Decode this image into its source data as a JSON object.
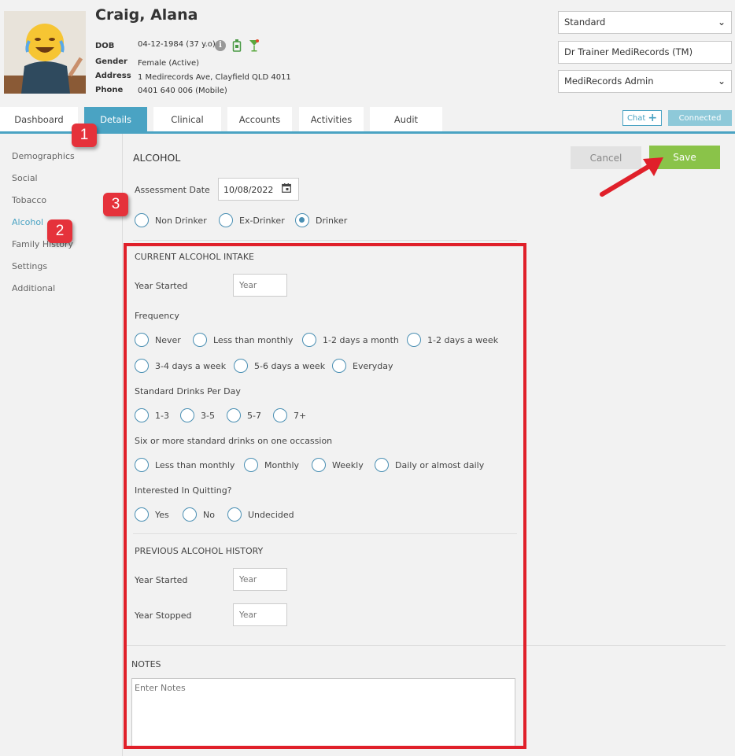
{
  "patient": {
    "name": "Craig, Alana",
    "dob_label": "DOB",
    "dob": "04-12-1984 (37 y.o)",
    "gender_label": "Gender",
    "gender": "Female (Active)",
    "address_label": "Address",
    "address": "1 Medirecords Ave, Clayfield QLD 4011",
    "phone_label": "Phone",
    "phone": "0401 640 006 (Mobile)",
    "icons": [
      "info-icon",
      "bottle-icon",
      "cocktail-icon"
    ]
  },
  "header_controls": {
    "mode_select": "Standard",
    "practitioner": "Dr Trainer MediRecords (TM)",
    "role_select": "MediRecords Admin"
  },
  "tabs": [
    "Dashboard",
    "Details",
    "Clinical",
    "Accounts",
    "Activities",
    "Audit"
  ],
  "active_tab": "Details",
  "chat_label": "Chat",
  "connected_label": "Connected",
  "sidebar": [
    "Demographics",
    "Social",
    "Tobacco",
    "Alcohol",
    "Family History",
    "Settings",
    "Additional"
  ],
  "active_sidebar": "Alcohol",
  "badges": [
    "1",
    "2",
    "3"
  ],
  "form": {
    "title": "ALCOHOL",
    "cancel_label": "Cancel",
    "save_label": "Save",
    "assessment_date_label": "Assessment Date",
    "assessment_date": "10/08/2022",
    "drinker_status": [
      "Non Drinker",
      "Ex-Drinker",
      "Drinker"
    ],
    "drinker_selected": "Drinker",
    "current_title": "CURRENT ALCOHOL INTAKE",
    "year_started_label": "Year Started",
    "year_placeholder": "Year",
    "frequency_label": "Frequency",
    "frequency_options": [
      "Never",
      "Less than monthly",
      "1-2 days a month",
      "1-2 days a week",
      "3-4 days a week",
      "5-6 days a week",
      "Everyday"
    ],
    "drinks_label": "Standard Drinks Per Day",
    "drinks_options": [
      "1-3",
      "3-5",
      "5-7",
      "7+"
    ],
    "six_label": "Six or more standard drinks on one occassion",
    "six_options": [
      "Less than monthly",
      "Monthly",
      "Weekly",
      "Daily or almost daily"
    ],
    "quit_label": "Interested In Quitting?",
    "quit_options": [
      "Yes",
      "No",
      "Undecided"
    ],
    "previous_title": "PREVIOUS ALCOHOL HISTORY",
    "prev_year_started_label": "Year Started",
    "prev_year_stopped_label": "Year Stopped",
    "notes_title": "NOTES",
    "notes_placeholder": "Enter Notes"
  },
  "colors": {
    "accent": "#4aa3c3",
    "save": "#8ac349",
    "highlight": "#e0202a"
  }
}
